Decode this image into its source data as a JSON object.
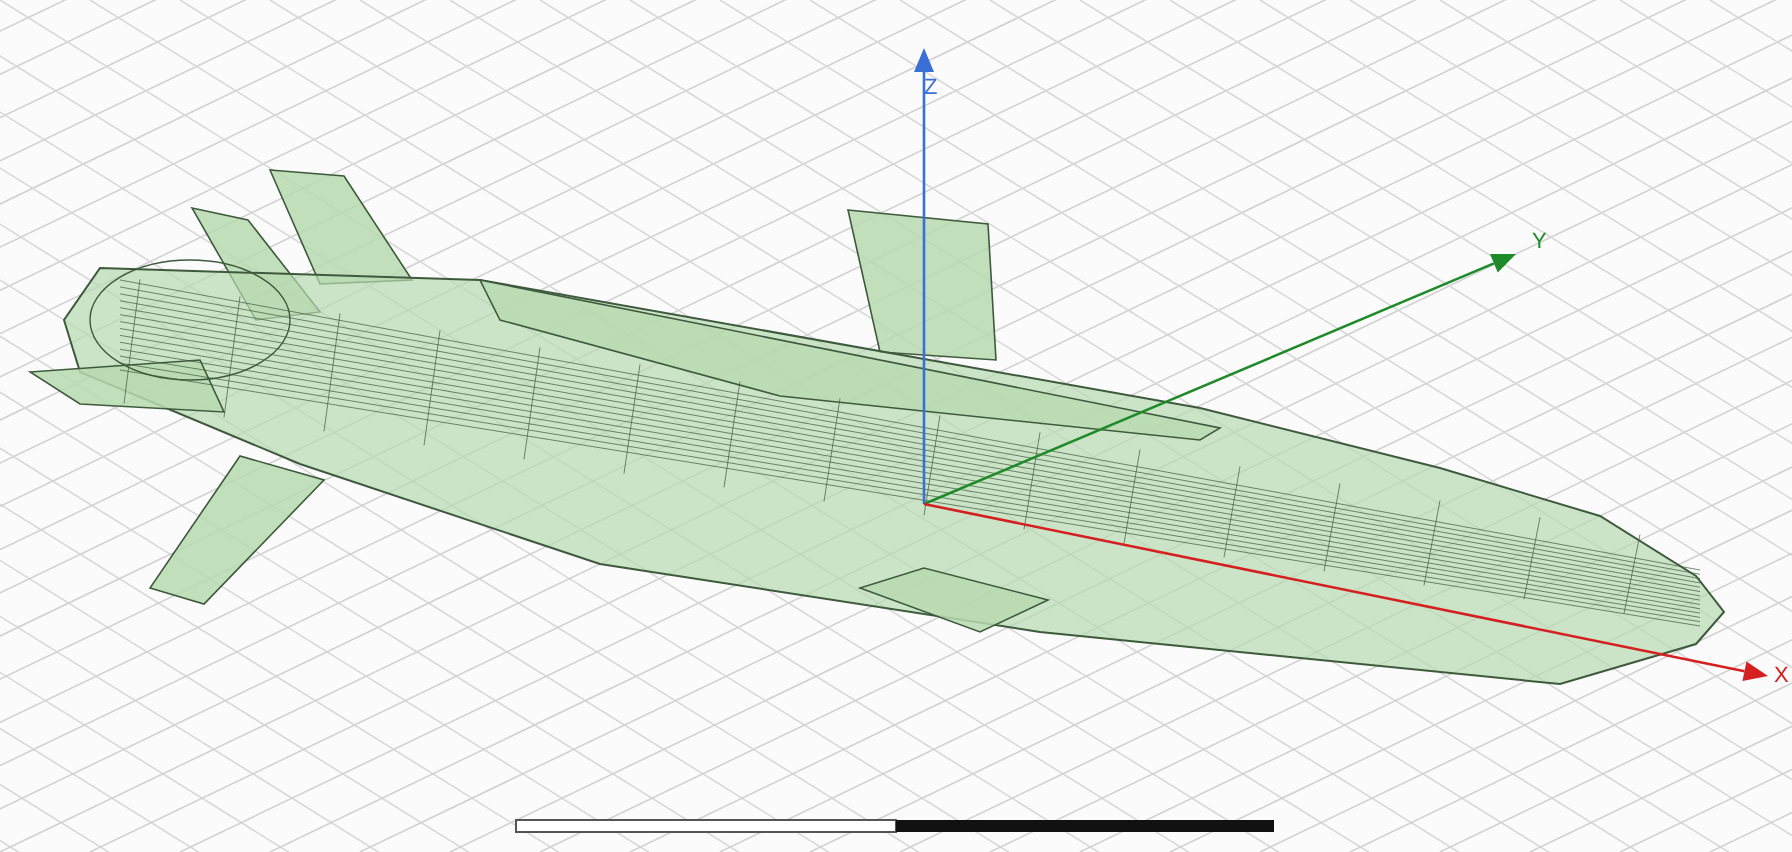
{
  "viewport": {
    "axes": [
      {
        "kind": "z",
        "label": "Z",
        "color": "#3a6fd8"
      },
      {
        "kind": "y",
        "label": "Y",
        "color": "#1f8a2a"
      },
      {
        "kind": "x",
        "label": "X",
        "color": "#d42020"
      }
    ]
  }
}
